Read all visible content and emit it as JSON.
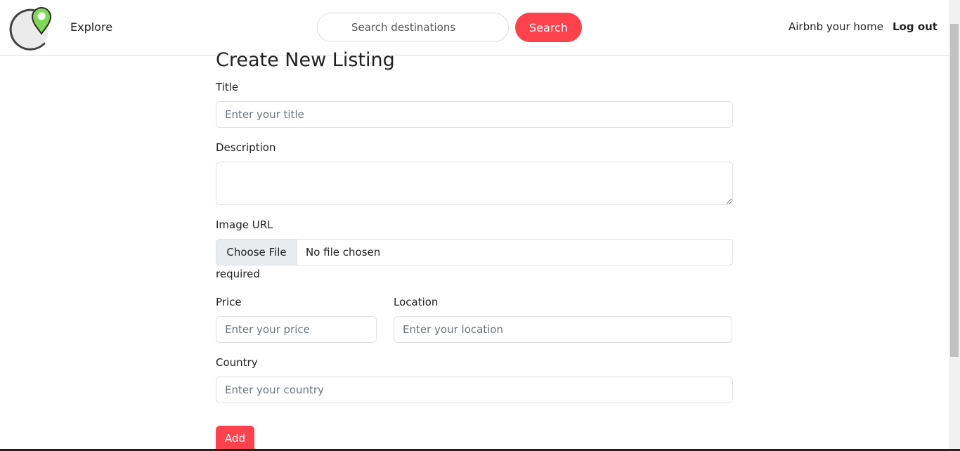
{
  "navbar": {
    "explore_label": "Explore",
    "search_placeholder": "Search destinations",
    "search_button": "Search",
    "host_link": "Airbnb your home",
    "logout_link": "Log out",
    "accent_color": "#fe424d",
    "logo_pin_color": "#7ed957"
  },
  "form": {
    "title": "Create New Listing",
    "title_label": "Title",
    "title_placeholder": "Enter your title",
    "description_label": "Description",
    "image_label": "Image URL",
    "file_button": "Choose File",
    "file_status": "No file chosen",
    "image_note": "required",
    "price_label": "Price",
    "price_placeholder": "Enter your price",
    "location_label": "Location",
    "location_placeholder": "Enter your location",
    "country_label": "Country",
    "country_placeholder": "Enter your country",
    "submit_label": "Add"
  }
}
